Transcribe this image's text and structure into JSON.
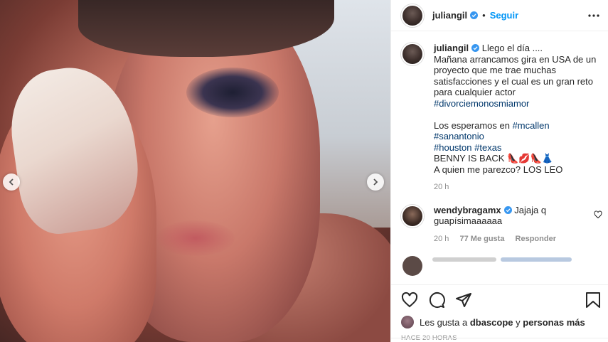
{
  "post": {
    "username": "juliangil",
    "follow_label": "Seguir",
    "separator": "•"
  },
  "caption": {
    "username": "juliangil",
    "line1": "Llego el día ....",
    "line2": "Mañana arrancamos gira en USA de un proyecto que me trae muchas satisfacciones y el cual es un gran reto para cualquier actor",
    "hashtag1": "#divorciemonosmiamor",
    "line3": "Los esperamos en",
    "hashtag_mcallen": "#mcallen",
    "hashtag_sanantonio": "#sanantonio",
    "hashtag_houston": "#houston",
    "hashtag_texas": "#texas",
    "line4": "BENNY IS BACK",
    "emojis": "👠💋👠👗",
    "line5": "A quien me parezco? LOS LEO",
    "time": "20 h"
  },
  "comment": {
    "username": "wendybragamx",
    "text": "Jajaja q guapísimaaaaaa",
    "time": "20 h",
    "likes": "77 Me gusta",
    "reply": "Responder"
  },
  "likes": {
    "prefix": "Les gusta a",
    "user": "dbascope",
    "connector": "y",
    "others": "personas más"
  },
  "timestamp": "HACE 20 HORAS",
  "icons": {
    "heart": "heart-icon",
    "comment": "comment-icon",
    "share": "share-icon",
    "save": "bookmark-icon",
    "more": "more-icon",
    "verified": "verified-icon",
    "prev": "chevron-left-icon",
    "next": "chevron-right-icon"
  },
  "colors": {
    "link": "#0095f6",
    "hashtag": "#00376b",
    "muted": "#8e8e8e"
  }
}
